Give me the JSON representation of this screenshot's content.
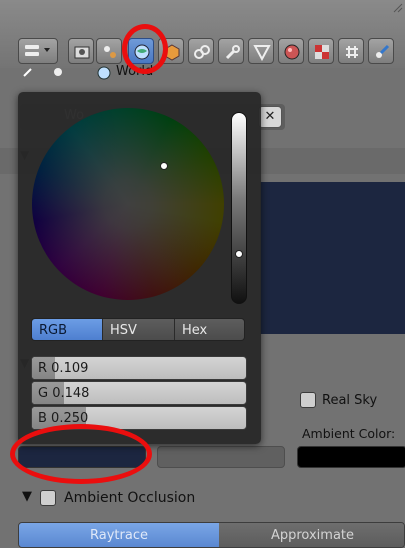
{
  "toolbar": {
    "buttons": [
      {
        "icon": "editor-type-icon"
      },
      {
        "icon": "render-camera-icon"
      },
      {
        "icon": "render-layers-icon"
      },
      {
        "icon": "world-icon",
        "active": true
      },
      {
        "icon": "object-icon"
      },
      {
        "icon": "constraints-icon"
      },
      {
        "icon": "modifiers-icon"
      },
      {
        "icon": "data-icon"
      },
      {
        "icon": "material-icon"
      },
      {
        "icon": "texture-icon"
      },
      {
        "icon": "particles-icon"
      },
      {
        "icon": "physics-icon"
      }
    ]
  },
  "breadcrumb": {
    "label": "World"
  },
  "world_field": {
    "value": "Wo"
  },
  "close_label": "✕",
  "world_settings": {
    "real_sky_label": "Real Sky",
    "ambient_color_label": "Ambient Color:",
    "horizon_color": "#1c2640",
    "zenith_color": "#1c2640",
    "ambient_color": "#000000"
  },
  "ambient_occlusion": {
    "label": "Ambient Occlusion",
    "tabs": [
      "Raytrace",
      "Approximate"
    ],
    "active_tab": "Raytrace"
  },
  "color_picker": {
    "modes": [
      "RGB",
      "HSV",
      "Hex"
    ],
    "active_mode": "RGB",
    "r_label": "R 0.109",
    "g_label": "G 0.148",
    "b_label": "B 0.250",
    "r": 0.109,
    "g": 0.148,
    "b": 0.25,
    "value_slider_level": 0.25
  },
  "annotation_color": "#ea0e0e"
}
